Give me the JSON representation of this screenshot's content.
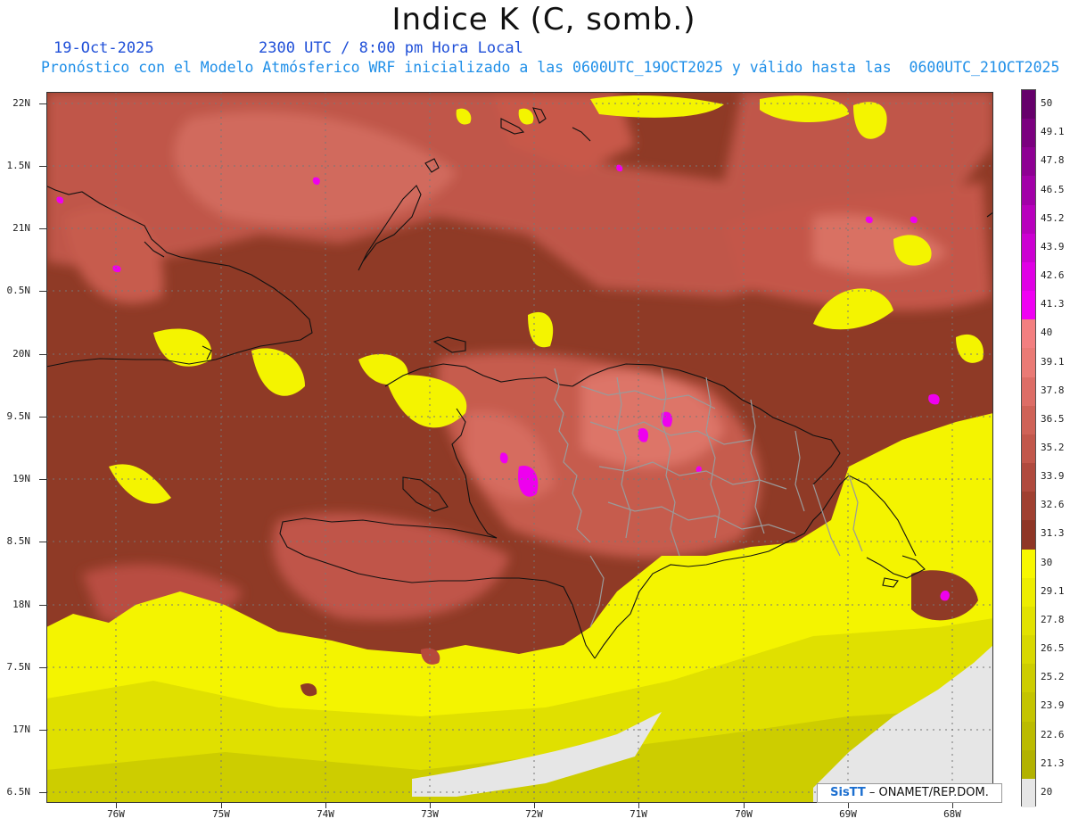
{
  "header": {
    "title": "Indice K (C, somb.)",
    "date": "19-Oct-2025",
    "time": "2300 UTC / 8:00 pm Hora Local",
    "subtitle": "Pronóstico con el Modelo Atmósferico WRF inicializado a las 0600UTC_19OCT2025 y válido hasta las  0600UTC_21OCT2025"
  },
  "map": {
    "lat_labels": [
      "22N",
      "1.5N",
      "21N",
      "0.5N",
      "20N",
      "9.5N",
      "19N",
      "8.5N",
      "18N",
      "7.5N",
      "17N",
      "6.5N"
    ],
    "lon_labels": [
      "76W",
      "75W",
      "74W",
      "73W",
      "72W",
      "71W",
      "70W",
      "69W",
      "68W"
    ],
    "colors": {
      "below_20": "#e8e8e8",
      "low_yellow": "#c8c800",
      "mid_yellow": "#e8e800",
      "high_yellow": "#f7f700",
      "brown": "#8f3a26",
      "salmon": "#c95a4a",
      "pink": "#e97f7c",
      "magenta": "#ee00ee",
      "purple": "#7a007a",
      "border": "#111111",
      "provinces": "#999999"
    }
  },
  "colorbar": {
    "labels": [
      "50",
      "49.1",
      "47.8",
      "46.5",
      "45.2",
      "43.9",
      "42.6",
      "41.3",
      "40",
      "39.1",
      "37.8",
      "36.5",
      "35.2",
      "33.9",
      "32.6",
      "31.3",
      "30",
      "29.1",
      "27.8",
      "26.5",
      "25.2",
      "23.9",
      "22.6",
      "21.3",
      "20"
    ],
    "colors": [
      "#66006b",
      "#7b007f",
      "#8e0093",
      "#a200a8",
      "#b800bd",
      "#cc00d2",
      "#e000e5",
      "#f000f3",
      "#f37f80",
      "#ea7a75",
      "#dd6d66",
      "#cf6257",
      "#c2574b",
      "#b04a3e",
      "#a04031",
      "#8f3626",
      "#f7f700",
      "#eded00",
      "#e2e200",
      "#d8d800",
      "#cdcd00",
      "#c4c400",
      "#bbbb00",
      "#b2b200",
      "#e6e6e6"
    ]
  },
  "credit": {
    "brand": "SisTT",
    "org": " – ONAMET/REP.DOM."
  }
}
